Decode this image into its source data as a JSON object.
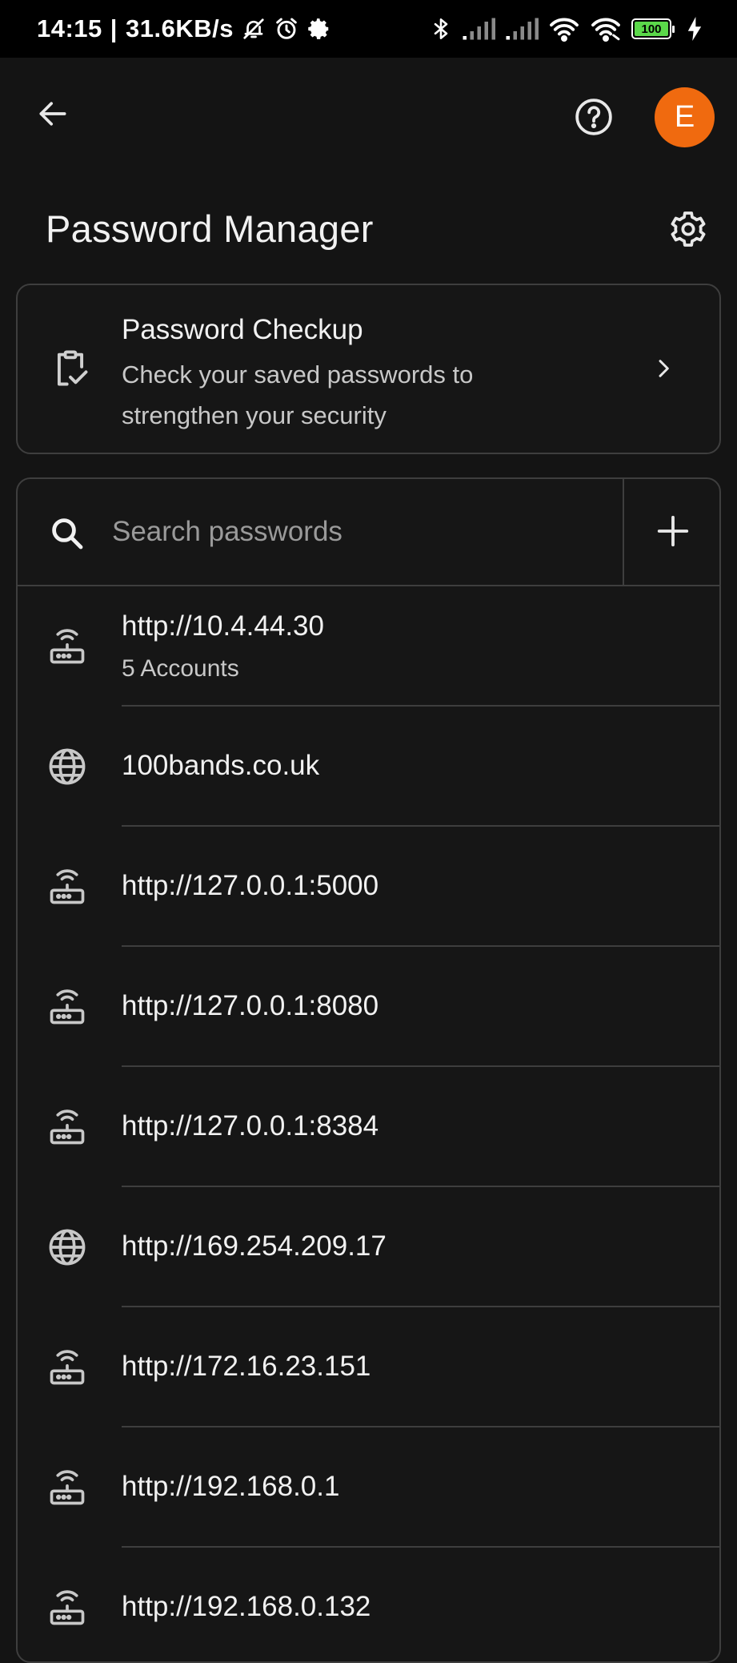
{
  "status_bar": {
    "time": "14:15",
    "speed": "31.6KB/s",
    "battery": "100",
    "icons": [
      "dnd-icon",
      "alarm-icon",
      "settings-icon",
      "bluetooth-icon",
      "signal-icon",
      "signal-icon",
      "wifi-icon",
      "hotspot-icon",
      "battery-icon",
      "charging-icon"
    ]
  },
  "app_bar": {
    "avatar_letter": "E",
    "avatar_color": "#f06a0f"
  },
  "page": {
    "title": "Password Manager"
  },
  "checkup": {
    "title": "Password Checkup",
    "description": "Check your saved passwords to strengthen your security"
  },
  "search": {
    "placeholder": "Search passwords",
    "value": ""
  },
  "entries": [
    {
      "site": "http://10.4.44.30",
      "sub": "5 Accounts",
      "icon": "router-icon"
    },
    {
      "site": "100bands.co.uk",
      "sub": "",
      "icon": "globe-icon"
    },
    {
      "site": "http://127.0.0.1:5000",
      "sub": "",
      "icon": "router-icon"
    },
    {
      "site": "http://127.0.0.1:8080",
      "sub": "",
      "icon": "router-icon"
    },
    {
      "site": "http://127.0.0.1:8384",
      "sub": "",
      "icon": "router-icon"
    },
    {
      "site": "http://169.254.209.17",
      "sub": "",
      "icon": "globe-icon"
    },
    {
      "site": "http://172.16.23.151",
      "sub": "",
      "icon": "router-icon"
    },
    {
      "site": "http://192.168.0.1",
      "sub": "",
      "icon": "router-icon"
    },
    {
      "site": "http://192.168.0.132",
      "sub": "",
      "icon": "router-icon"
    }
  ]
}
